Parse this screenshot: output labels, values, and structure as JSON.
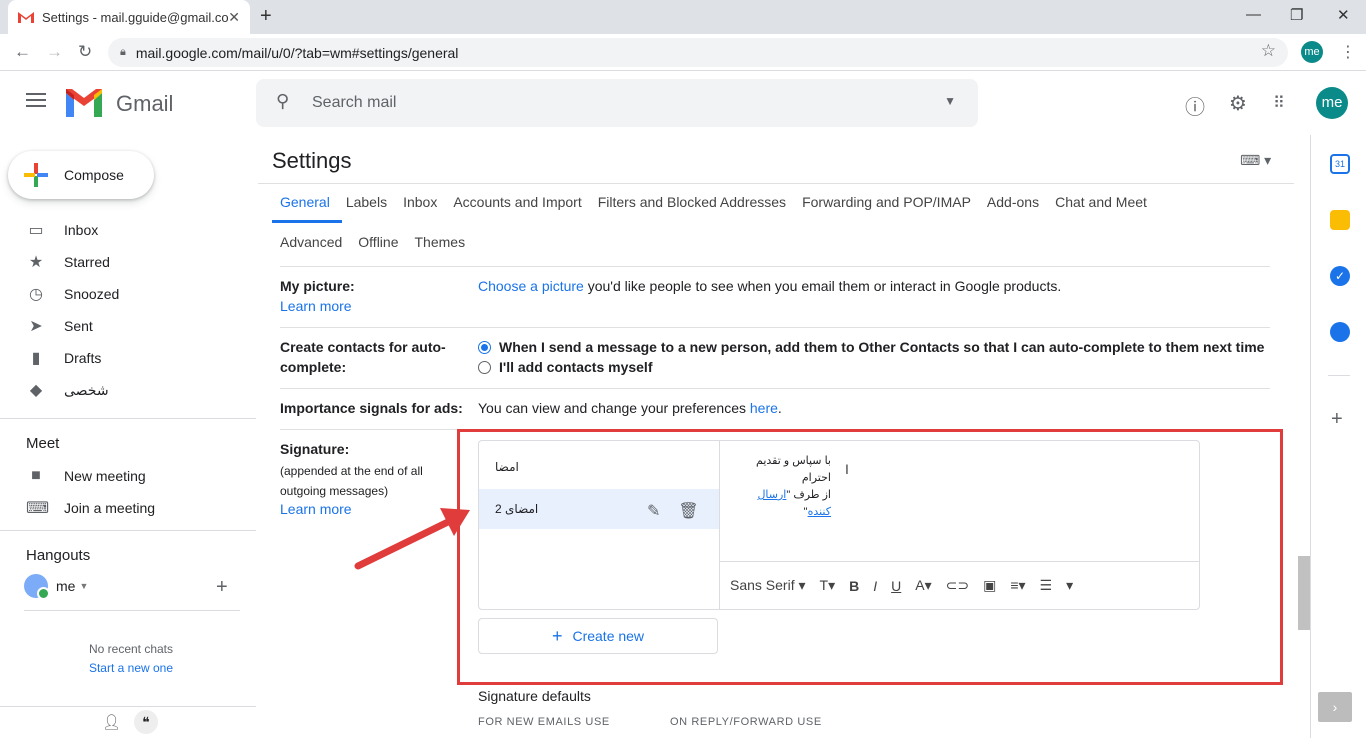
{
  "browser": {
    "tab_title": "Settings - mail.gguide@gmail.co",
    "tab_close": "✕",
    "new_tab": "+",
    "url": "mail.google.com/mail/u/0/?tab=wm#settings/general",
    "avatar": "me"
  },
  "header": {
    "app_name": "Gmail",
    "search_placeholder": "Search mail",
    "avatar": "me"
  },
  "sidebar": {
    "compose": "Compose",
    "items": [
      {
        "label": "Inbox",
        "icon": "inbox-icon"
      },
      {
        "label": "Starred",
        "icon": "star-icon"
      },
      {
        "label": "Snoozed",
        "icon": "clock-icon"
      },
      {
        "label": "Sent",
        "icon": "send-icon"
      },
      {
        "label": "Drafts",
        "icon": "draft-icon"
      },
      {
        "label": "شخصی",
        "icon": "label-icon"
      }
    ],
    "meet_title": "Meet",
    "meet_items": [
      {
        "label": "New meeting",
        "icon": "video-icon"
      },
      {
        "label": "Join a meeting",
        "icon": "keyboard-icon"
      }
    ],
    "hangouts_title": "Hangouts",
    "hangouts_user": "me",
    "no_chats": "No recent chats",
    "start_new": "Start a new one"
  },
  "settings": {
    "title": "Settings",
    "tabs_row1": [
      "General",
      "Labels",
      "Inbox",
      "Accounts and Import",
      "Filters and Blocked Addresses",
      "Forwarding and POP/IMAP",
      "Add-ons",
      "Chat and Meet"
    ],
    "tabs_row2": [
      "Advanced",
      "Offline",
      "Themes"
    ],
    "active_tab": "General",
    "my_picture": {
      "label": "My picture:",
      "learn_more": "Learn more",
      "link": "Choose a picture",
      "text": " you'd like people to see when you email them or interact in Google products."
    },
    "contacts": {
      "label1": "Create contacts for auto-",
      "label2": "complete:",
      "option1": "When I send a message to a new person, add them to Other Contacts so that I can auto-complete to them next time",
      "option2": "I'll add contacts myself",
      "selected": 0
    },
    "ads": {
      "label": "Importance signals for ads:",
      "text": "You can view and change your preferences ",
      "link": "here",
      "end": "."
    },
    "signature": {
      "label": "Signature:",
      "sub1": "(appended at the end of all",
      "sub2": "outgoing messages)",
      "learn_more": "Learn more",
      "list": [
        "امضا",
        "امضای 2"
      ],
      "selected": 1,
      "editor_line1": "با سپاس و تقدیم احترام",
      "editor_line2_prefix": "از طرف \"",
      "editor_line2_link": "ارسال کننده",
      "editor_line2_suffix": "\"",
      "font": "Sans Serif",
      "create_new": "Create new"
    },
    "sig_defaults": {
      "title": "Signature defaults",
      "new_emails": "FOR NEW EMAILS USE",
      "reply": "ON REPLY/FORWARD USE"
    }
  },
  "colors": {
    "accent": "#1a73e8",
    "highlight_box": "#e03c3c",
    "arrow": "#e03c3c"
  }
}
